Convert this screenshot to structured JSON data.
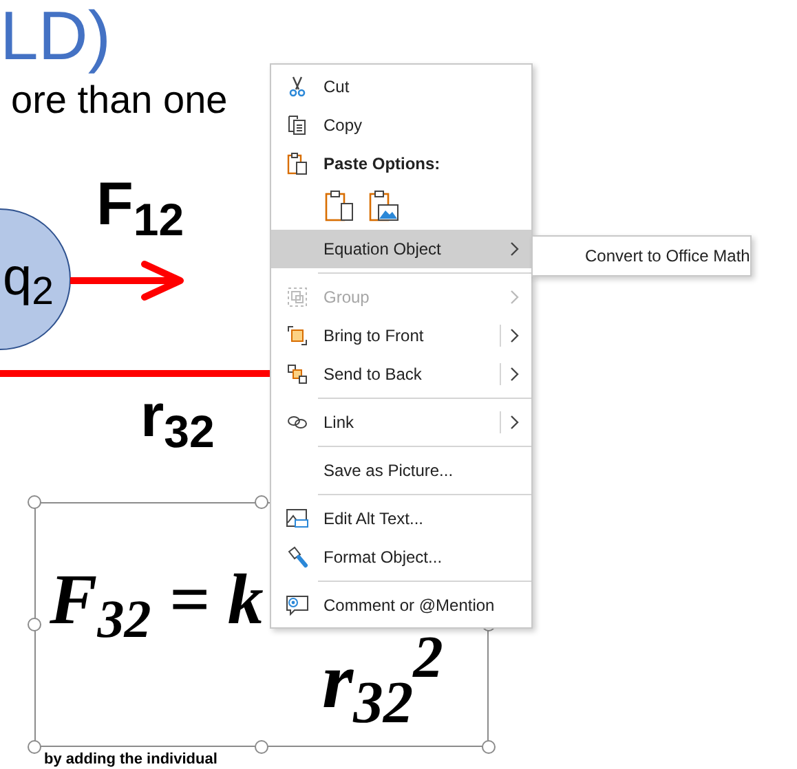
{
  "slide": {
    "title": "LD)",
    "line_1": "ore than one",
    "charge_label": "q$_{2}$",
    "force_label": "F$_{12}$",
    "distance_label": "r$_{32}$",
    "equation": {
      "lhs": "F$_{32}$ = k",
      "denominator": "r$_{32}$$^{2}$",
      "selected": true
    },
    "line_2": "by adding the individual"
  },
  "context_menu": {
    "items": [
      {
        "kind": "item",
        "label": "Cut",
        "disabled": false,
        "selected": false,
        "submenu": false
      },
      {
        "kind": "item",
        "label": "Copy",
        "disabled": false,
        "selected": false,
        "submenu": false
      },
      {
        "kind": "header",
        "label": "Paste Options:"
      },
      {
        "kind": "paste-icons"
      },
      {
        "kind": "item",
        "label": "Equation Object",
        "disabled": false,
        "selected": true,
        "submenu": true,
        "split": false
      },
      {
        "kind": "separator"
      },
      {
        "kind": "item",
        "label": "Group",
        "disabled": true,
        "selected": false,
        "submenu": true,
        "split": false
      },
      {
        "kind": "item",
        "label": "Bring to Front",
        "disabled": false,
        "selected": false,
        "submenu": true,
        "split": true
      },
      {
        "kind": "item",
        "label": "Send to Back",
        "disabled": false,
        "selected": false,
        "submenu": true,
        "split": true
      },
      {
        "kind": "separator"
      },
      {
        "kind": "item",
        "label": "Link",
        "disabled": false,
        "selected": false,
        "submenu": true,
        "split": true
      },
      {
        "kind": "separator"
      },
      {
        "kind": "item",
        "label": "Save as Picture...",
        "disabled": false,
        "selected": false,
        "submenu": false
      },
      {
        "kind": "separator"
      },
      {
        "kind": "item",
        "label": "Edit Alt Text...",
        "disabled": false,
        "selected": false,
        "submenu": false
      },
      {
        "kind": "item",
        "label": "Format Object...",
        "disabled": false,
        "selected": false,
        "submenu": false
      },
      {
        "kind": "separator"
      },
      {
        "kind": "item",
        "label": "Comment or @Mention",
        "disabled": false,
        "selected": false,
        "submenu": false
      }
    ],
    "submenu": {
      "items": [
        {
          "label": "Convert to Office Math"
        }
      ]
    }
  }
}
